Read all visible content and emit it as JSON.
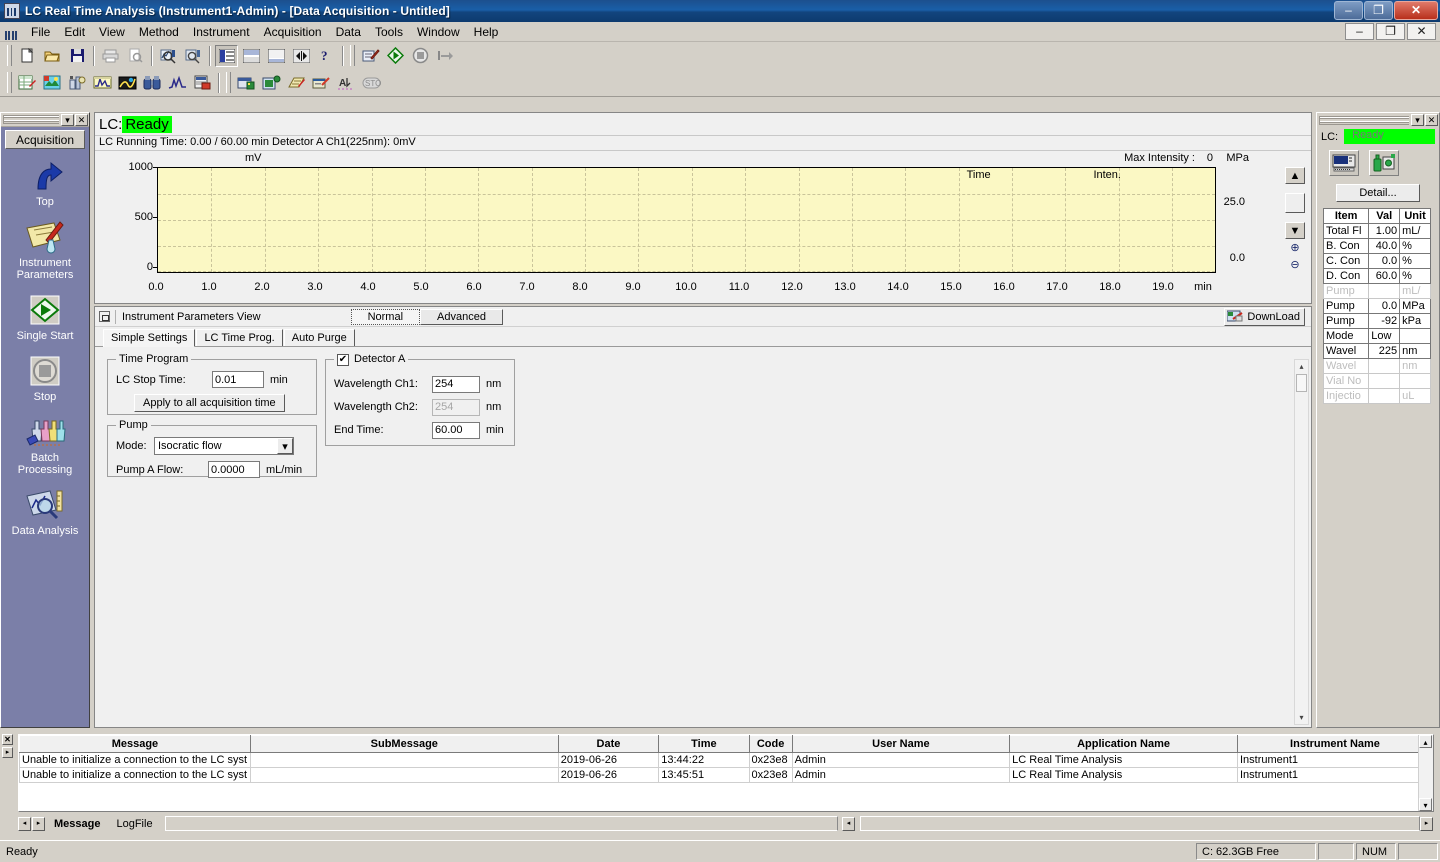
{
  "window": {
    "title": "LC Real Time Analysis (Instrument1-Admin) - [Data Acquisition - Untitled]",
    "minimize": "–",
    "maximize": "❐",
    "close": "✕",
    "mdi_minimize": "–",
    "mdi_restore": "❐",
    "mdi_close": "✕"
  },
  "menu": {
    "items": [
      {
        "label": "File"
      },
      {
        "label": "Edit"
      },
      {
        "label": "View"
      },
      {
        "label": "Method"
      },
      {
        "label": "Instrument"
      },
      {
        "label": "Acquisition"
      },
      {
        "label": "Data"
      },
      {
        "label": "Tools"
      },
      {
        "label": "Window"
      },
      {
        "label": "Help"
      }
    ]
  },
  "toolbar_row1": [
    {
      "name": "new-file-icon"
    },
    {
      "name": "open-file-icon"
    },
    {
      "name": "save-icon"
    },
    {
      "name": "print-icon"
    },
    {
      "name": "print-preview-icon"
    },
    {
      "name": "data-search-icon"
    },
    {
      "name": "data-search2-icon"
    },
    {
      "name": "view-split-vertical-icon"
    },
    {
      "name": "view-split-horizontal-icon"
    },
    {
      "name": "view-single-icon"
    },
    {
      "name": "view-expand-icon"
    },
    {
      "name": "help-icon"
    },
    {
      "name": "method-edit-icon"
    },
    {
      "name": "single-start-icon"
    },
    {
      "name": "stop-icon"
    },
    {
      "name": "next-icon"
    }
  ],
  "toolbar_row2": [
    {
      "name": "method-table-icon"
    },
    {
      "name": "sample-login-icon"
    },
    {
      "name": "instrument-config-icon"
    },
    {
      "name": "chromatogram-icon"
    },
    {
      "name": "spectrum-icon"
    },
    {
      "name": "binoculars-icon"
    },
    {
      "name": "curve-icon"
    },
    {
      "name": "report-icon"
    },
    {
      "name": "batch-table-icon"
    },
    {
      "name": "batch-start-icon"
    },
    {
      "name": "batch-edit-icon"
    },
    {
      "name": "batch-queue-icon"
    },
    {
      "name": "autosample-icon"
    },
    {
      "name": "stop-round-icon"
    }
  ],
  "sidebar": {
    "tab_label": "Acquisition",
    "dropdown_caret": "▾",
    "close_label": "✕",
    "items": [
      {
        "label": "Top",
        "icon": "up-arrow-icon"
      },
      {
        "label": "Instrument\nParameters",
        "icon": "instrument-parameters-icon"
      },
      {
        "label": "Single Start",
        "icon": "single-start-icon"
      },
      {
        "label": "Stop",
        "icon": "stop-icon"
      },
      {
        "label": "Batch\nProcessing",
        "icon": "batch-processing-icon"
      },
      {
        "label": "Data Analysis",
        "icon": "data-analysis-icon"
      }
    ]
  },
  "chromatogram": {
    "lc_prefix": "LC:",
    "lc_status": "Ready",
    "status_color": "#00ff00",
    "running_info": "LC Running Time: 0.00 / 60.00 min  Detector A Ch1(225nm): 0mV",
    "max_intensity_label": "Max Intensity :",
    "max_intensity_value": "0",
    "right_unit": "MPa",
    "legend_time": "Time",
    "legend_inten": "Inten.",
    "scroll_up": "▲",
    "scroll_down": "▼",
    "zoom_in": "⊕",
    "zoom_out": "⊖"
  },
  "chart_data": {
    "type": "line",
    "title": "",
    "xlabel": "min",
    "ylabel": "mV",
    "series": [
      {
        "name": "Detector A Ch1(225nm)",
        "x": [],
        "y": [],
        "color": "#000080"
      }
    ],
    "x_ticks": [
      "0.0",
      "1.0",
      "2.0",
      "3.0",
      "4.0",
      "5.0",
      "6.0",
      "7.0",
      "8.0",
      "9.0",
      "10.0",
      "11.0",
      "12.0",
      "13.0",
      "14.0",
      "15.0",
      "16.0",
      "17.0",
      "18.0",
      "19.0"
    ],
    "xlim": [
      0.0,
      19.8
    ],
    "y_ticks": [
      "0",
      "500",
      "1000"
    ],
    "ylim": [
      0,
      1000
    ],
    "y2_label": "MPa",
    "y2_ticks": [
      "0.0",
      "25.0"
    ],
    "y2lim": [
      0,
      50
    ],
    "grid": true,
    "plot_bg": "#fbf8c4",
    "legend": [
      "Time",
      "Inten."
    ],
    "legend_position": "top-inside"
  },
  "params": {
    "view_title": "Instrument Parameters View",
    "mode_tabs": [
      {
        "label": "Normal",
        "selected": true
      },
      {
        "label": "Advanced",
        "selected": false
      }
    ],
    "download_label": "DownLoad",
    "tabs": [
      {
        "label": "Simple Settings",
        "selected": true
      },
      {
        "label": "LC Time Prog.",
        "selected": false
      },
      {
        "label": "Auto Purge",
        "selected": false
      }
    ],
    "time_program": {
      "legend": "Time Program",
      "stop_time_label": "LC Stop Time:",
      "stop_time_value": "0.01",
      "stop_time_unit": "min",
      "apply_button": "Apply to all acquisition time"
    },
    "pump": {
      "legend": "Pump",
      "mode_label": "Mode:",
      "mode_value": "Isocratic flow",
      "mode_options": [
        "Isocratic flow"
      ],
      "flow_label": "Pump A Flow:",
      "flow_value": "0.0000",
      "flow_unit": "mL/min",
      "arrow": "▾"
    },
    "detector": {
      "legend": "Detector A",
      "checked": true,
      "check_glyph": "✔",
      "ch1_label": "Wavelength Ch1:",
      "ch1_value": "254",
      "ch1_unit": "nm",
      "ch2_label": "Wavelength Ch2:",
      "ch2_value": "254",
      "ch2_unit": "nm",
      "ch2_disabled": true,
      "end_time_label": "End Time:",
      "end_time_value": "60.00",
      "end_time_unit": "min"
    }
  },
  "status_dock": {
    "lc_label": "LC:",
    "lc_status": "Ready",
    "icons": [
      {
        "name": "instrument-monitor-icon"
      },
      {
        "name": "solvent-bottle-icon"
      }
    ],
    "detail_button": "Detail...",
    "table": {
      "headers": [
        "Item",
        "Val",
        "Unit"
      ],
      "rows": [
        {
          "item": "Total Fl",
          "val": "1.00",
          "unit": "mL/",
          "dim": false
        },
        {
          "item": "B. Con",
          "val": "40.0",
          "unit": "%",
          "dim": false
        },
        {
          "item": "C. Con",
          "val": "0.0",
          "unit": "%",
          "dim": false
        },
        {
          "item": "D. Con",
          "val": "60.0",
          "unit": "%",
          "dim": false
        },
        {
          "item": "Pump",
          "val": "",
          "unit": "mL/",
          "dim": true
        },
        {
          "item": "Pump",
          "val": "0.0",
          "unit": "MPa",
          "dim": false
        },
        {
          "item": "Pump",
          "val": "-92",
          "unit": "kPa",
          "dim": false
        },
        {
          "item": "Mode",
          "val": "Low",
          "unit": "",
          "dim": false
        },
        {
          "item": "Wavel",
          "val": "225",
          "unit": "nm",
          "dim": false
        },
        {
          "item": "Wavel",
          "val": "",
          "unit": "nm",
          "dim": true
        },
        {
          "item": "Vial No",
          "val": "",
          "unit": "",
          "dim": true
        },
        {
          "item": "Injectio",
          "val": "",
          "unit": "uL",
          "dim": true
        }
      ]
    }
  },
  "log": {
    "close_label": "✕",
    "expand_label": "▸",
    "columns": [
      "Message",
      "SubMessage",
      "Date",
      "Time",
      "Code",
      "User Name",
      "Application Name",
      "Instrument Name"
    ],
    "rows": [
      {
        "message": "Unable to initialize a connection to the LC syst",
        "submessage": "",
        "date": "2019-06-26",
        "time": "13:44:22",
        "code": "0x23e8",
        "user": "Admin",
        "application": "LC Real Time Analysis",
        "instrument": "Instrument1"
      },
      {
        "message": "Unable to initialize a connection to the LC syst",
        "submessage": "",
        "date": "2019-06-26",
        "time": "13:45:51",
        "code": "0x23e8",
        "user": "Admin",
        "application": "LC Real Time Analysis",
        "instrument": "Instrument1"
      }
    ],
    "sheets": [
      {
        "label": "Message",
        "selected": true
      },
      {
        "label": "LogFile",
        "selected": false
      }
    ],
    "nav_prev": "◂",
    "nav_next": "▸",
    "scroll_up": "▴",
    "scroll_down": "▾",
    "hscroll_left": "◂",
    "hscroll_right": "▸"
  },
  "statusbar": {
    "message": "Ready",
    "disk": "C: 62.3GB Free",
    "blank": "",
    "num": "NUM"
  }
}
